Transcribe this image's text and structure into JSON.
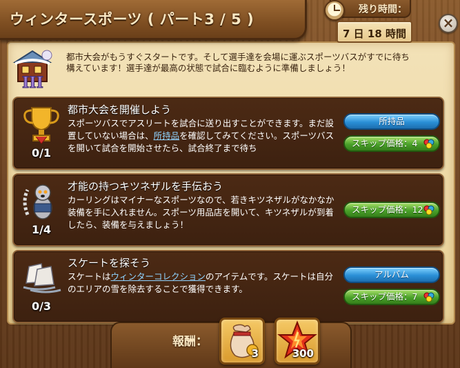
{
  "header": {
    "title": "ウィンタースポーツ ( パート3 / 5 )"
  },
  "timer": {
    "label": "残り時間：",
    "value": "7 日 18 時間"
  },
  "intro": {
    "text": "都市大会がもうすぐスタートです。そして選手達を会場に運ぶスポーツバスがすでに待ち構えています！選手達が最高の状態で試合に臨むように準備しましょう！"
  },
  "quests": [
    {
      "title": "都市大会を開催しよう",
      "desc_before": "スポーツバスでアスリートを試合に送り出すことができます。まだ設置していない場合は、",
      "desc_link": "所持品",
      "desc_after": "を確認してみてください。スポーツバスを開いて試合を開始させたら、試合終了まで待ち",
      "progress": "0/1",
      "button": "所持品",
      "skip": "スキップ価格：4"
    },
    {
      "title": "才能の持つキツネザルを手伝おう",
      "desc": "カーリングはマイナーなスポーツなので、若きキツネザルがなかなか装備を手に入れません。スポーツ用品店を開いて、キツネザルが到着したら、装備を与えましょう！",
      "progress": "1/4",
      "skip": "スキップ価格：12"
    },
    {
      "title": "スケートを探そう",
      "desc_before": "スケートは",
      "desc_link": "ウィンターコレクション",
      "desc_after": "のアイテムです。スケートは自分のエリアの雪を除去することで獲得できます。",
      "progress": "0/3",
      "button": "アルバム",
      "skip": "スキップ価格：7"
    }
  ],
  "rewards": {
    "label": "報酬：",
    "items": [
      {
        "icon": "lucky-pouch-icon",
        "count": "3"
      },
      {
        "icon": "experience-star-icon",
        "count": "300"
      }
    ]
  },
  "colors": {
    "parchment": "#ead397",
    "panel": "#3d2110",
    "button_blue": "#2a8fd6",
    "button_green": "#4aa12a",
    "link": "#8fd3ff"
  }
}
